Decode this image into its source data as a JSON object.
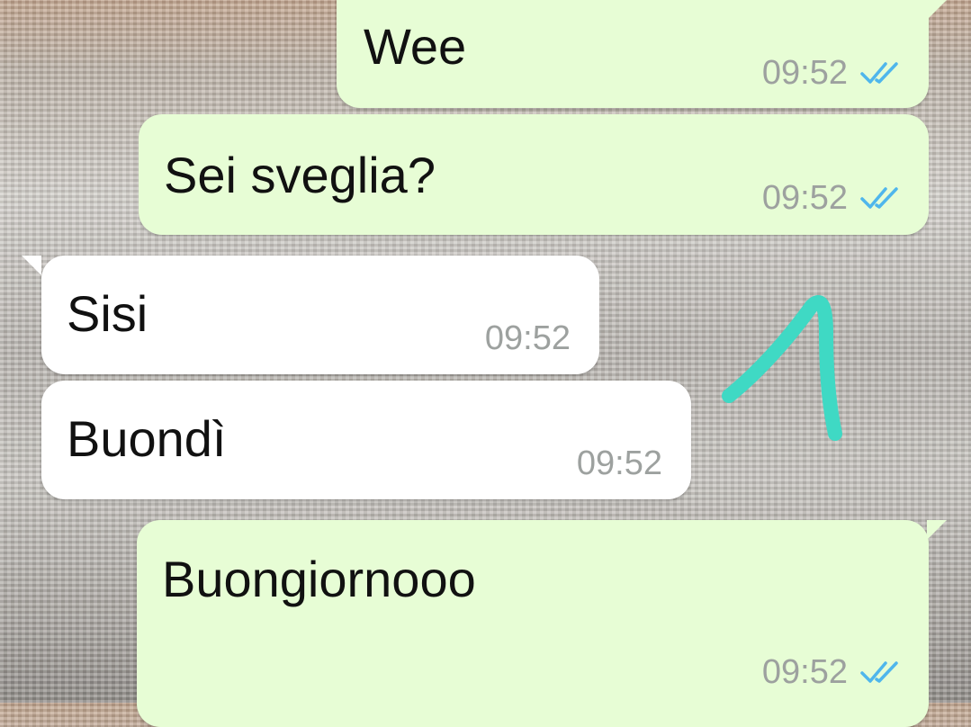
{
  "messages": [
    {
      "direction": "outgoing",
      "text": "Wee",
      "time": "09:52",
      "status_icon": "double-check-read-icon"
    },
    {
      "direction": "outgoing",
      "text": "Sei sveglia?",
      "time": "09:52",
      "status_icon": "double-check-read-icon"
    },
    {
      "direction": "incoming",
      "text": "Sisi",
      "time": "09:52"
    },
    {
      "direction": "incoming",
      "text": "Buondì",
      "time": "09:52"
    },
    {
      "direction": "outgoing",
      "text": "Buongiornooo",
      "time": "09:52",
      "status_icon": "double-check-read-icon"
    }
  ],
  "colors": {
    "outgoing_bubble": "#e7fdd5",
    "incoming_bubble": "#ffffff",
    "read_checks": "#4fb6ec",
    "time_text": "#9da19f",
    "drawn_arrow": "#3fd9c4"
  },
  "annotation": {
    "icon": "hand-drawn-arrow-icon"
  }
}
